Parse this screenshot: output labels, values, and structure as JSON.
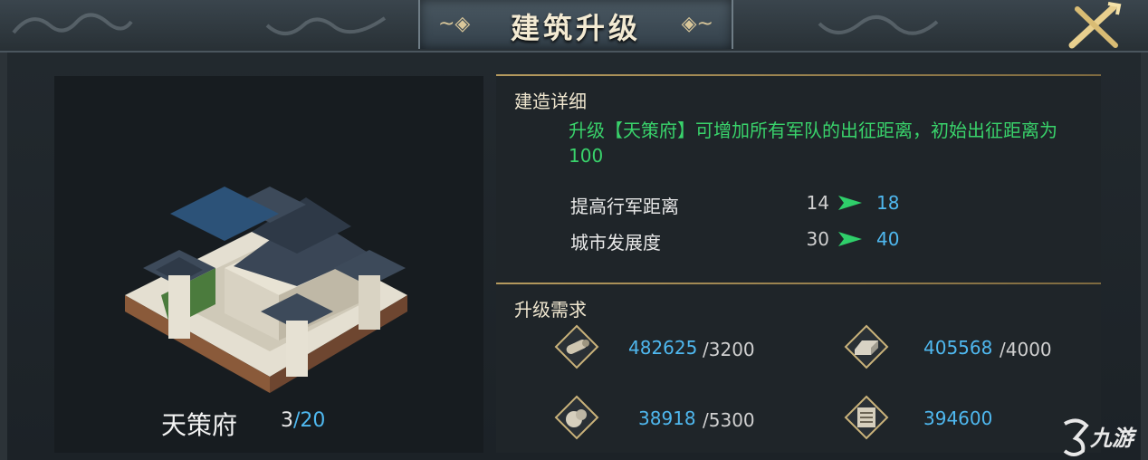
{
  "window": {
    "title": "建筑升级",
    "close_icon": "crossed-swords-close-icon"
  },
  "building": {
    "name": "天策府",
    "level_current": "3",
    "level_separator": "/",
    "level_max": "20",
    "image": "palace-building-illustration"
  },
  "details": {
    "section_title": "建造详细",
    "description": "升级【天策府】可增加所有军队的出征距离，初始出征距离为100",
    "stats": [
      {
        "label": "提高行军距离",
        "from": "14",
        "to": "18"
      },
      {
        "label": "城市发展度",
        "from": "30",
        "to": "40"
      }
    ],
    "arrow_icon": "green-arrow-icon"
  },
  "requirements": {
    "section_title": "升级需求",
    "items": [
      {
        "icon": "wood-log-icon",
        "have": "482625",
        "need": "/3200"
      },
      {
        "icon": "iron-ingot-icon",
        "have": "405568",
        "need": "/4000"
      },
      {
        "icon": "stone-icon",
        "have": "38918",
        "need": "/5300"
      },
      {
        "icon": "scroll-icon",
        "have": "394600",
        "need": ""
      }
    ]
  },
  "watermark": {
    "text": "九游",
    "icon": "jiuyou-logo-icon"
  },
  "colors": {
    "accent_gold": "#b59a5e",
    "value_blue": "#4fb8ef",
    "desc_green": "#39d36b"
  }
}
